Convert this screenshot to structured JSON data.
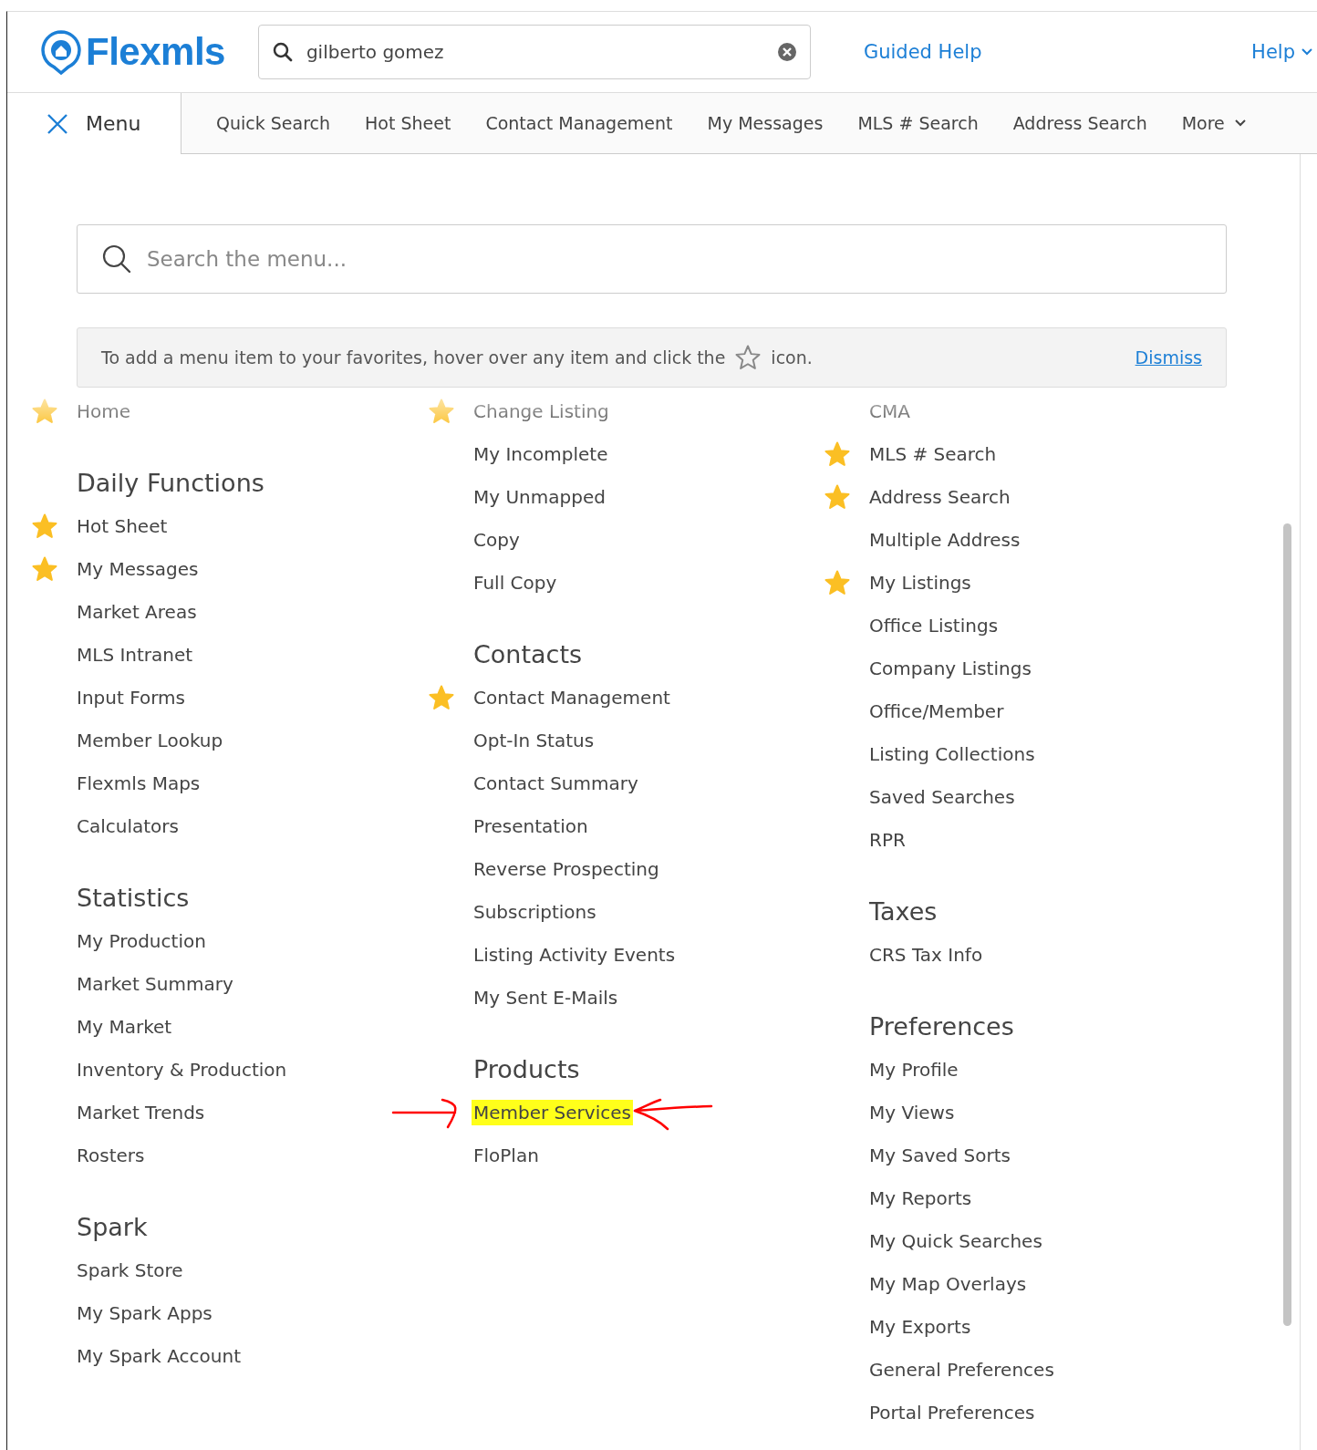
{
  "header": {
    "logo": "Flexmls",
    "search": {
      "value": "gilberto gomez"
    },
    "links": [
      "Guided Help",
      "Help"
    ]
  },
  "nav": {
    "menu_tab": {
      "label": "Menu",
      "selected": true
    },
    "items": [
      "Quick Search",
      "Hot Sheet",
      "Contact Management",
      "My Messages",
      "MLS # Search",
      "Address Search",
      "More"
    ]
  },
  "menu_search": {
    "placeholder": "Search the menu..."
  },
  "notice": {
    "text_before": "To add a menu item to your favorites, hover over any item and click the",
    "text_after": "icon.",
    "dismiss": "Dismiss"
  },
  "columns": [
    {
      "items": [
        {
          "kind": "item",
          "label": "Home",
          "starred": true,
          "highlighted": false
        },
        {
          "kind": "heading",
          "label": "Daily Functions"
        },
        {
          "kind": "item",
          "label": "Hot Sheet",
          "starred": true,
          "highlighted": false
        },
        {
          "kind": "item",
          "label": "My Messages",
          "starred": true,
          "highlighted": false
        },
        {
          "kind": "item",
          "label": "Market Areas",
          "starred": false,
          "highlighted": false
        },
        {
          "kind": "item",
          "label": "MLS Intranet",
          "starred": false,
          "highlighted": false
        },
        {
          "kind": "item",
          "label": "Input Forms",
          "starred": false,
          "highlighted": false
        },
        {
          "kind": "item",
          "label": "Member Lookup",
          "starred": false,
          "highlighted": false
        },
        {
          "kind": "item",
          "label": "Flexmls Maps",
          "starred": false,
          "highlighted": false
        },
        {
          "kind": "item",
          "label": "Calculators",
          "starred": false,
          "highlighted": false
        },
        {
          "kind": "heading",
          "label": "Statistics"
        },
        {
          "kind": "item",
          "label": "My Production",
          "starred": false,
          "highlighted": false
        },
        {
          "kind": "item",
          "label": "Market Summary",
          "starred": false,
          "highlighted": false
        },
        {
          "kind": "item",
          "label": "My Market",
          "starred": false,
          "highlighted": false
        },
        {
          "kind": "item",
          "label": "Inventory & Production",
          "starred": false,
          "highlighted": false
        },
        {
          "kind": "item",
          "label": "Market Trends",
          "starred": false,
          "highlighted": false
        },
        {
          "kind": "item",
          "label": "Rosters",
          "starred": false,
          "highlighted": false
        },
        {
          "kind": "heading",
          "label": "Spark"
        },
        {
          "kind": "item",
          "label": "Spark Store",
          "starred": false,
          "highlighted": false
        },
        {
          "kind": "item",
          "label": "My Spark Apps",
          "starred": false,
          "highlighted": false
        },
        {
          "kind": "item",
          "label": "My Spark Account",
          "starred": false,
          "highlighted": false
        }
      ]
    },
    {
      "items": [
        {
          "kind": "item",
          "label": "Change Listing",
          "starred": true,
          "highlighted": false
        },
        {
          "kind": "item",
          "label": "My Incomplete",
          "starred": false,
          "highlighted": false
        },
        {
          "kind": "item",
          "label": "My Unmapped",
          "starred": false,
          "highlighted": false
        },
        {
          "kind": "item",
          "label": "Copy",
          "starred": false,
          "highlighted": false
        },
        {
          "kind": "item",
          "label": "Full Copy",
          "starred": false,
          "highlighted": false
        },
        {
          "kind": "heading",
          "label": "Contacts"
        },
        {
          "kind": "item",
          "label": "Contact Management",
          "starred": true,
          "highlighted": false
        },
        {
          "kind": "item",
          "label": "Opt-In Status",
          "starred": false,
          "highlighted": false
        },
        {
          "kind": "item",
          "label": "Contact Summary",
          "starred": false,
          "highlighted": false
        },
        {
          "kind": "item",
          "label": "Presentation",
          "starred": false,
          "highlighted": false
        },
        {
          "kind": "item",
          "label": "Reverse Prospecting",
          "starred": false,
          "highlighted": false
        },
        {
          "kind": "item",
          "label": "Subscriptions",
          "starred": false,
          "highlighted": false
        },
        {
          "kind": "item",
          "label": "Listing Activity Events",
          "starred": false,
          "highlighted": false
        },
        {
          "kind": "item",
          "label": "My Sent E-Mails",
          "starred": false,
          "highlighted": false
        },
        {
          "kind": "heading",
          "label": "Products"
        },
        {
          "kind": "item",
          "label": "Member Services",
          "starred": false,
          "highlighted": true
        },
        {
          "kind": "item",
          "label": "FloPlan",
          "starred": false,
          "highlighted": false
        }
      ]
    },
    {
      "items": [
        {
          "kind": "item",
          "label": "CMA",
          "starred": false,
          "highlighted": false
        },
        {
          "kind": "item",
          "label": "MLS # Search",
          "starred": true,
          "highlighted": false
        },
        {
          "kind": "item",
          "label": "Address Search",
          "starred": true,
          "highlighted": false
        },
        {
          "kind": "item",
          "label": "Multiple Address",
          "starred": false,
          "highlighted": false
        },
        {
          "kind": "item",
          "label": "My Listings",
          "starred": true,
          "highlighted": false
        },
        {
          "kind": "item",
          "label": "Office Listings",
          "starred": false,
          "highlighted": false
        },
        {
          "kind": "item",
          "label": "Company Listings",
          "starred": false,
          "highlighted": false
        },
        {
          "kind": "item",
          "label": "Office/Member",
          "starred": false,
          "highlighted": false
        },
        {
          "kind": "item",
          "label": "Listing Collections",
          "starred": false,
          "highlighted": false
        },
        {
          "kind": "item",
          "label": "Saved Searches",
          "starred": false,
          "highlighted": false
        },
        {
          "kind": "item",
          "label": "RPR",
          "starred": false,
          "highlighted": false
        },
        {
          "kind": "heading",
          "label": "Taxes"
        },
        {
          "kind": "item",
          "label": "CRS Tax Info",
          "starred": false,
          "highlighted": false
        },
        {
          "kind": "heading",
          "label": "Preferences"
        },
        {
          "kind": "item",
          "label": "My Profile",
          "starred": false,
          "highlighted": false
        },
        {
          "kind": "item",
          "label": "My Views",
          "starred": false,
          "highlighted": false
        },
        {
          "kind": "item",
          "label": "My Saved Sorts",
          "starred": false,
          "highlighted": false
        },
        {
          "kind": "item",
          "label": "My Reports",
          "starred": false,
          "highlighted": false
        },
        {
          "kind": "item",
          "label": "My Quick Searches",
          "starred": false,
          "highlighted": false
        },
        {
          "kind": "item",
          "label": "My Map Overlays",
          "starred": false,
          "highlighted": false
        },
        {
          "kind": "item",
          "label": "My Exports",
          "starred": false,
          "highlighted": false
        },
        {
          "kind": "item",
          "label": "General Preferences",
          "starred": false,
          "highlighted": false
        },
        {
          "kind": "item",
          "label": "Portal Preferences",
          "starred": false,
          "highlighted": false
        }
      ]
    }
  ]
}
